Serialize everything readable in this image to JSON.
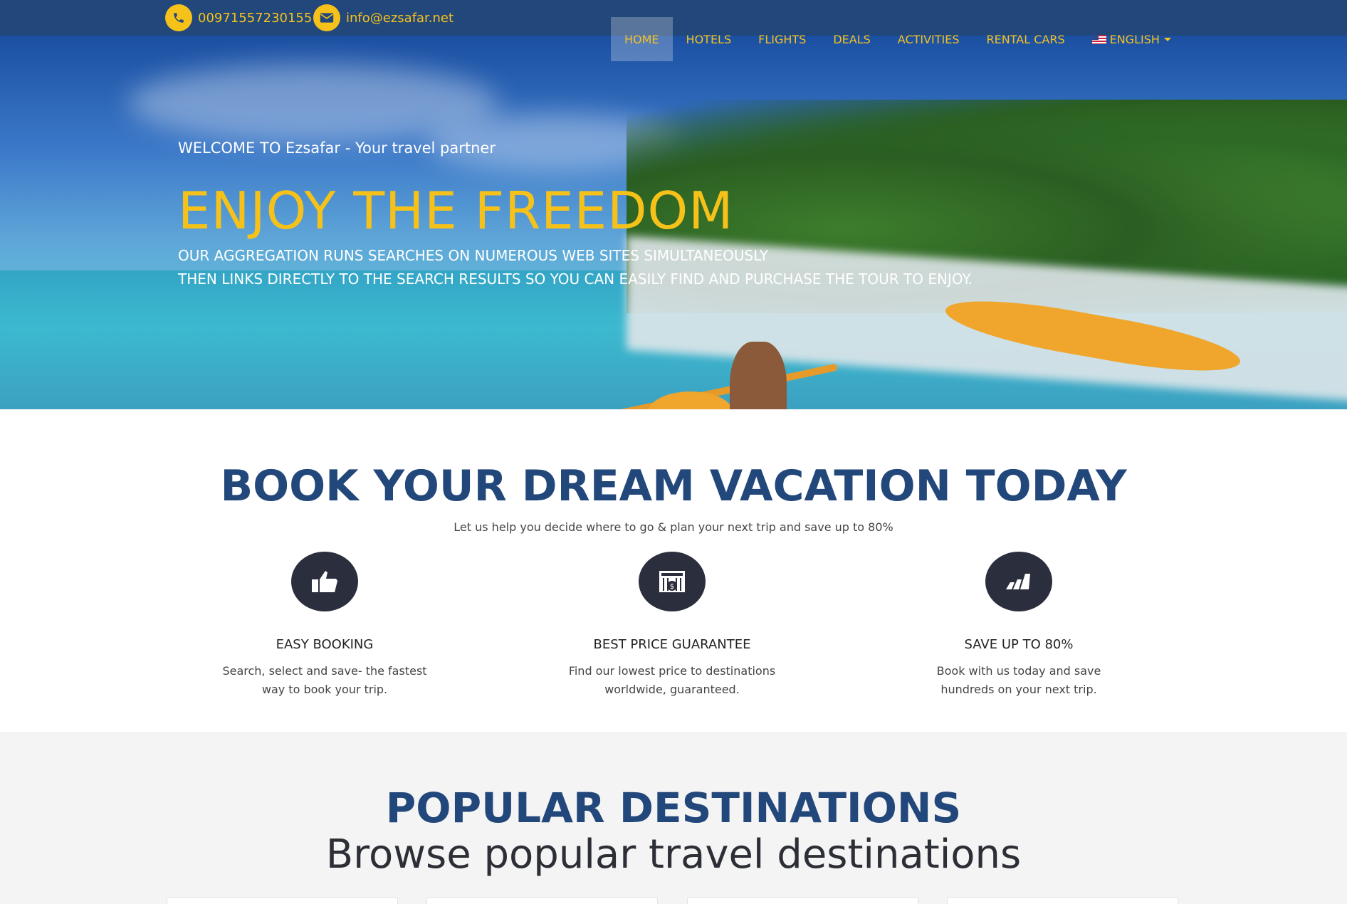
{
  "contact": {
    "phone": "00971557230155",
    "email": "info@ezsafar.net"
  },
  "nav": {
    "items": [
      {
        "label": "HOME",
        "active": true
      },
      {
        "label": "HOTELS"
      },
      {
        "label": "FLIGHTS"
      },
      {
        "label": "DEALS"
      },
      {
        "label": "ACTIVITIES"
      },
      {
        "label": "RENTAL CARS"
      }
    ],
    "language": "ENGLISH"
  },
  "hero": {
    "welcome": "WELCOME TO Ezsafar - Your travel partner",
    "headline": "ENJOY THE FREEDOM",
    "tagline_1": "OUR AGGREGATION RUNS SEARCHES ON NUMEROUS WEB SITES SIMULTANEOUSLY",
    "tagline_2": "THEN LINKS DIRECTLY TO THE SEARCH RESULTS SO YOU CAN EASILY FIND AND PURCHASE THE TOUR TO ENJOY."
  },
  "booking": {
    "title": "BOOK YOUR DREAM VACATION TODAY",
    "subtitle": "Let us help you decide where to go & plan your next trip and save up to 80%",
    "features": [
      {
        "icon": "thumbs-up-icon",
        "title": "EASY BOOKING",
        "text_1": "Search, select and save- the fastest",
        "text_2": "way to book your trip."
      },
      {
        "icon": "price-tag-icon",
        "title": "BEST PRICE GUARANTEE",
        "text_1": "Find our lowest price to destinations",
        "text_2": "worldwide, guaranteed."
      },
      {
        "icon": "savings-icon",
        "title": "SAVE UP TO 80%",
        "text_1": "Book with us today and save",
        "text_2": "hundreds on your next trip."
      }
    ]
  },
  "popular": {
    "title": "POPULAR DESTINATIONS",
    "subtitle": "Browse popular travel destinations"
  },
  "colors": {
    "primary": "#22477a",
    "accent": "#f6c21a",
    "icon_bg": "#2b2f3d"
  }
}
